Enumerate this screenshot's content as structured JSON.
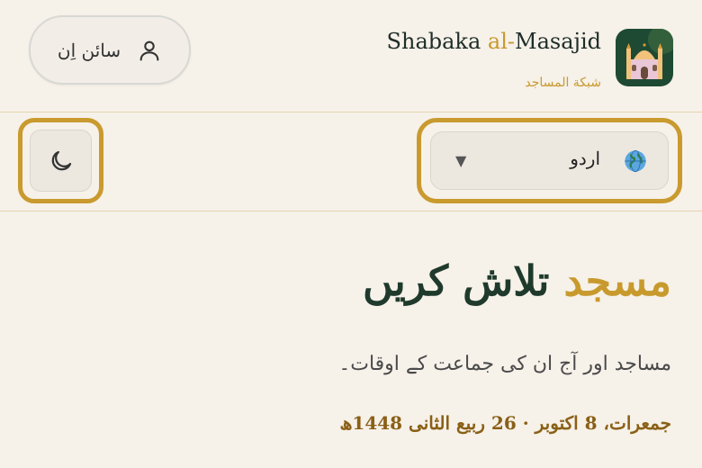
{
  "header": {
    "brand_prefix": "Shabaka ",
    "brand_accent": "al-",
    "brand_suffix": "Masajid",
    "brand_subtitle": "شبکة المساجد",
    "signin_label": "سائن اِن",
    "logo_icon": "mosque-icon"
  },
  "toolbar": {
    "language_label": "اردو",
    "language_icon": "globe-icon",
    "theme_icon": "moon-icon"
  },
  "main": {
    "title_accent": "مسجد",
    "title_rest": " تلاش کریں",
    "subtitle": "مساجد اور آج ان کی جماعت کے اوقات۔",
    "date_line": "جمعرات، 8 اکتوبر · 26 ربیع الثانی 1448ھ"
  },
  "colors": {
    "background": "#f6f1e9",
    "accent": "#c89a2e",
    "dark_green": "#1f3a2c"
  }
}
